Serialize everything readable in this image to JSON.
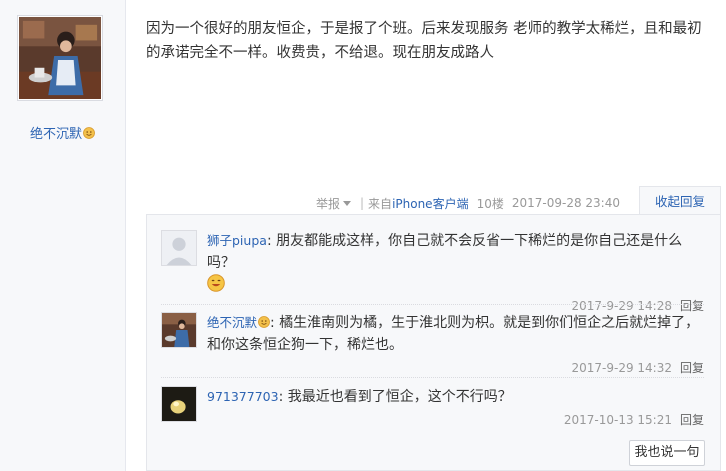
{
  "post": {
    "author": "绝不沉默",
    "text": "因为一个很好的朋友恒企，于是报了个班。后来发现服务 老师的教学太稀烂，且和最初的承诺完全不一样。收费贵，不给退。现在朋友成路人",
    "report_label": "举报",
    "source_prefix": "来自",
    "source_link": "iPhone客户端",
    "floor": "10楼",
    "time": "2017-09-28 23:40",
    "collapse_reply_label": "收起回复"
  },
  "replies": [
    {
      "name": "狮子piupa",
      "text": "朋友都能成这样，你自己就不会反省一下稀烂的是你自己还是什么吗？",
      "time": "2017-9-29 14:28",
      "reply_label": "回复"
    },
    {
      "name": "绝不沉默",
      "text": "橘生淮南则为橘，生于淮北则为枳。就是到你们恒企之后就烂掉了，和你这条恒企狗一下，稀烂也。",
      "time": "2017-9-29 14:32",
      "reply_label": "回复"
    },
    {
      "name": "971377703",
      "text": "我最近也看到了恒企，这个不行吗？",
      "time": "2017-10-13 15:21",
      "reply_label": "回复"
    }
  ],
  "say_button_label": "我也说一句",
  "colors": {
    "link": "#2d64b3",
    "panel_bg": "#f7f8fa",
    "meta": "#999999"
  }
}
